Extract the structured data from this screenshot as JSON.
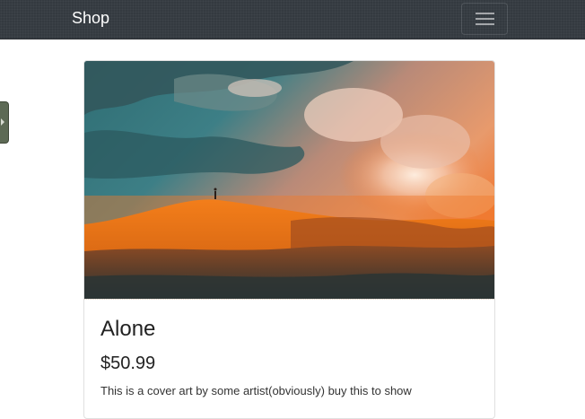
{
  "navbar": {
    "brand": "Shop",
    "toggler_icon": "hamburger-icon",
    "background_color": "#343a40"
  },
  "side_tab": {
    "icon": "caret-right-icon"
  },
  "product": {
    "image_icon": "landscape-artwork",
    "title": "Alone",
    "price": "$50.99",
    "description": "This is a cover art by some artist(obviously) buy this to show"
  }
}
